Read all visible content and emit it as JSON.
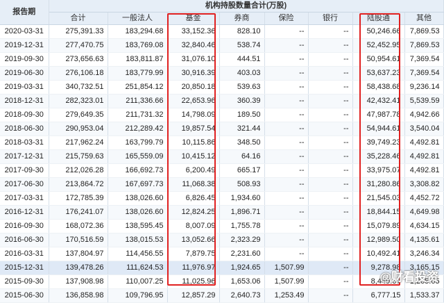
{
  "table": {
    "group_header": "机构持股数量合计(万股)",
    "period_header": "报告期",
    "columns": [
      "合计",
      "一般法人",
      "基金",
      "券商",
      "保险",
      "银行",
      "陆股通",
      "其他"
    ],
    "rows": [
      [
        "2020-03-31",
        "275,391.33",
        "183,294.68",
        "33,152.36",
        "828.10",
        "--",
        "--",
        "50,246.66",
        "7,869.53"
      ],
      [
        "2019-12-31",
        "277,470.75",
        "183,769.08",
        "32,840.46",
        "538.74",
        "--",
        "--",
        "52,452.95",
        "7,869.53"
      ],
      [
        "2019-09-30",
        "273,656.63",
        "183,811.87",
        "31,076.10",
        "444.51",
        "--",
        "--",
        "50,954.61",
        "7,369.54"
      ],
      [
        "2019-06-30",
        "276,106.18",
        "183,779.99",
        "30,916.39",
        "403.03",
        "--",
        "--",
        "53,637.23",
        "7,369.54"
      ],
      [
        "2019-03-31",
        "340,732.51",
        "251,854.12",
        "20,850.18",
        "539.63",
        "--",
        "--",
        "58,438.68",
        "9,236.14"
      ],
      [
        "2018-12-31",
        "282,323.01",
        "211,336.66",
        "22,653.96",
        "360.39",
        "--",
        "--",
        "42,432.41",
        "5,539.59"
      ],
      [
        "2018-09-30",
        "279,649.35",
        "211,731.32",
        "14,798.09",
        "189.50",
        "--",
        "--",
        "47,987.78",
        "4,942.66"
      ],
      [
        "2018-06-30",
        "290,953.04",
        "212,289.42",
        "19,857.54",
        "321.44",
        "--",
        "--",
        "54,944.61",
        "3,540.04"
      ],
      [
        "2018-03-31",
        "217,962.24",
        "163,799.79",
        "10,115.86",
        "348.50",
        "--",
        "--",
        "39,749.23",
        "4,492.81"
      ],
      [
        "2017-12-31",
        "215,759.63",
        "165,559.09",
        "10,415.12",
        "64.16",
        "--",
        "--",
        "35,228.46",
        "4,492.81"
      ],
      [
        "2017-09-30",
        "212,026.28",
        "166,692.73",
        "6,200.49",
        "665.17",
        "--",
        "--",
        "33,975.07",
        "4,492.81"
      ],
      [
        "2017-06-30",
        "213,864.72",
        "167,697.73",
        "11,068.38",
        "508.93",
        "--",
        "--",
        "31,280.86",
        "3,308.82"
      ],
      [
        "2017-03-31",
        "172,785.39",
        "138,026.60",
        "6,826.45",
        "1,934.60",
        "--",
        "--",
        "21,545.03",
        "4,452.72"
      ],
      [
        "2016-12-31",
        "176,241.07",
        "138,026.60",
        "12,824.25",
        "1,896.71",
        "--",
        "--",
        "18,844.15",
        "4,649.98"
      ],
      [
        "2016-09-30",
        "168,072.36",
        "138,595.45",
        "8,007.09",
        "1,755.78",
        "--",
        "--",
        "15,079.89",
        "4,634.15"
      ],
      [
        "2016-06-30",
        "170,516.59",
        "138,015.53",
        "13,052.66",
        "2,323.29",
        "--",
        "--",
        "12,989.50",
        "4,135.61"
      ],
      [
        "2016-03-31",
        "137,804.97",
        "114,456.55",
        "7,879.75",
        "2,231.60",
        "--",
        "--",
        "10,492.41",
        "3,246.34"
      ],
      [
        "2015-12-31",
        "139,478.26",
        "111,624.53",
        "11,976.97",
        "1,924.65",
        "1,507.99",
        "--",
        "9,278.98",
        "3,165.15"
      ],
      [
        "2015-09-30",
        "137,908.98",
        "110,007.25",
        "11,025.96",
        "1,653.06",
        "1,507.99",
        "--",
        "8,449.67",
        "1,265.05"
      ],
      [
        "2015-06-30",
        "136,858.98",
        "109,796.95",
        "12,857.29",
        "2,640.73",
        "1,253.49",
        "--",
        "6,777.15",
        "1,533.37"
      ]
    ]
  },
  "watermark": "@财看投资",
  "colors": {
    "header_bg": "#e6eef7",
    "highlight_box": "#e02020",
    "selected_row": "#dfe9f6"
  }
}
